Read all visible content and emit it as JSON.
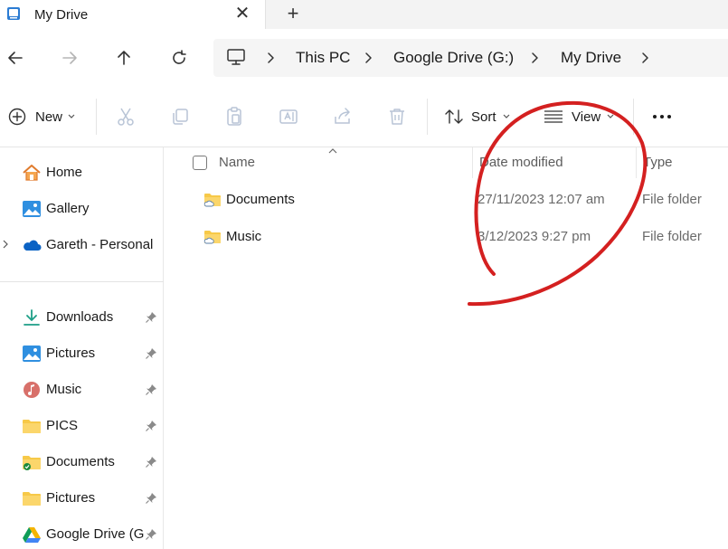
{
  "tab": {
    "title": "My Drive",
    "close_symbol": "✕",
    "new_tab_symbol": "+"
  },
  "address": {
    "crumbs": [
      "This PC",
      "Google Drive (G:)",
      "My Drive"
    ]
  },
  "toolbar": {
    "new_label": "New",
    "sort_label": "Sort",
    "view_label": "View"
  },
  "sidebar": {
    "top_items": [
      {
        "label": "Home",
        "icon": "home-icon"
      },
      {
        "label": "Gallery",
        "icon": "gallery-icon"
      },
      {
        "label": "Gareth - Personal",
        "icon": "onedrive-cloud-icon"
      }
    ],
    "pinned_items": [
      {
        "label": "Downloads",
        "icon": "download-icon"
      },
      {
        "label": "Pictures",
        "icon": "pictures-icon"
      },
      {
        "label": "Music",
        "icon": "music-icon"
      },
      {
        "label": "PICS",
        "icon": "folder-icon"
      },
      {
        "label": "Documents",
        "icon": "synced-folder-icon"
      },
      {
        "label": "Pictures",
        "icon": "folder-icon"
      },
      {
        "label": "Google Drive (G",
        "icon": "google-drive-icon"
      }
    ]
  },
  "columns": {
    "name": "Name",
    "date": "Date modified",
    "type": "Type"
  },
  "files": [
    {
      "name": "Documents",
      "date": "27/11/2023 12:07 am",
      "type": "File folder"
    },
    {
      "name": "Music",
      "date": "3/12/2023 9:27 pm",
      "type": "File folder"
    }
  ],
  "colors": {
    "accent": "#0067c0",
    "folder": "#f7c948",
    "annotation": "#d42020"
  }
}
